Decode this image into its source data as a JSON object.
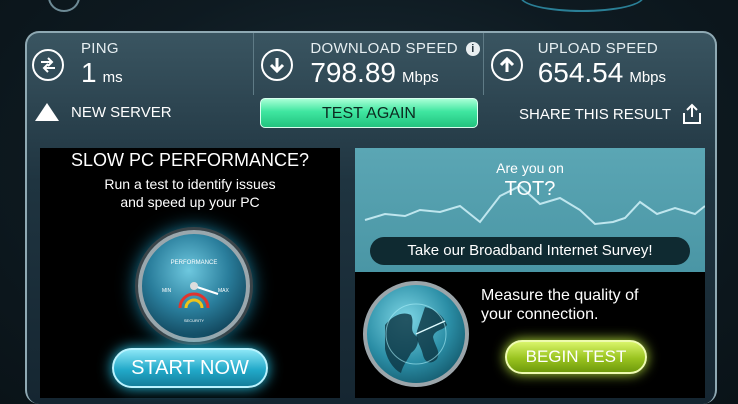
{
  "stats": {
    "ping": {
      "label": "PING",
      "value": "1",
      "unit": "ms"
    },
    "download": {
      "label": "DOWNLOAD SPEED",
      "value": "798.89",
      "unit": "Mbps",
      "info_icon": "i"
    },
    "upload": {
      "label": "UPLOAD SPEED",
      "value": "654.54",
      "unit": "Mbps"
    }
  },
  "actions": {
    "new_server": "NEW SERVER",
    "test_again": "TEST AGAIN",
    "share": "SHARE THIS RESULT"
  },
  "ad_pc": {
    "title": "SLOW PC PERFORMANCE?",
    "line1": "Run a test to identify issues",
    "line2": "and speed up your PC",
    "gauge_label": "PERFORMANCE",
    "gauge_min": "MIN",
    "gauge_max": "MAX",
    "gauge_sub": "SECURITY",
    "button": "START NOW"
  },
  "ad_survey": {
    "line1": "Are you on",
    "line2": "TOT?",
    "button": "Take our Broadband Internet Survey!",
    "measure1": "Measure the quality of",
    "measure2": "your connection.",
    "begin": "BEGIN TEST"
  },
  "colors": {
    "accent_green": "#3fe6a0",
    "accent_cyan": "#22a9c9",
    "accent_lime": "#99c31f"
  }
}
